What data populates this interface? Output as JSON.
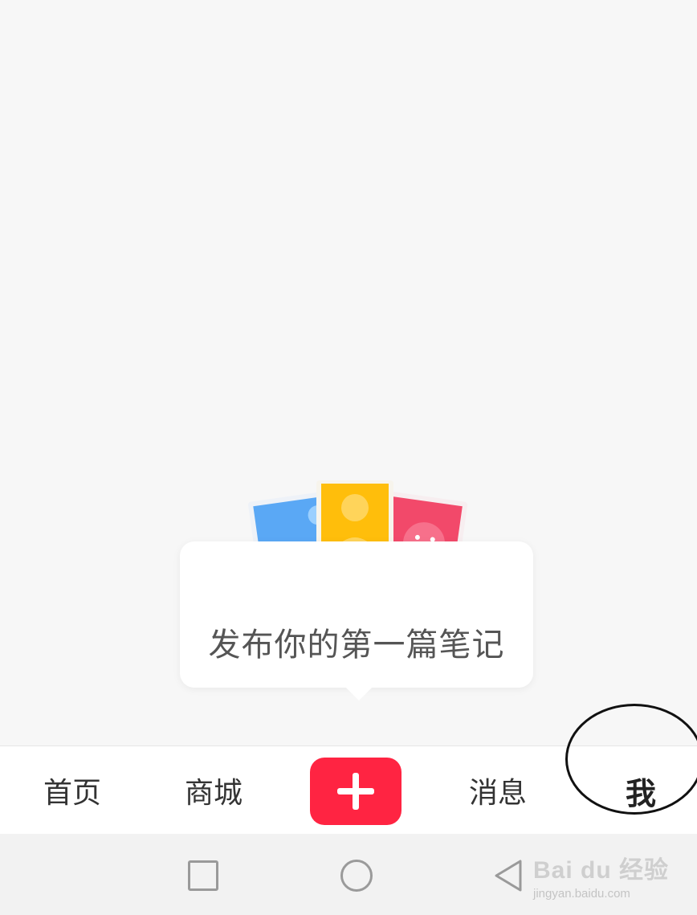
{
  "prompt": {
    "text": "发布你的第一篇笔记"
  },
  "tabbar": {
    "home_label": "首页",
    "mall_label": "商城",
    "add_icon": "plus-icon",
    "messages_label": "消息",
    "me_label": "我"
  },
  "navbar": {
    "recent_icon": "square-icon",
    "home_icon": "circle-icon",
    "back_icon": "triangle-back-icon"
  },
  "watermark": {
    "logo": "Bai du 经验",
    "url": "jingyan.baidu.com"
  },
  "colors": {
    "accent": "#ff2442",
    "background": "#f7f7f7",
    "tab_text": "#333333"
  }
}
